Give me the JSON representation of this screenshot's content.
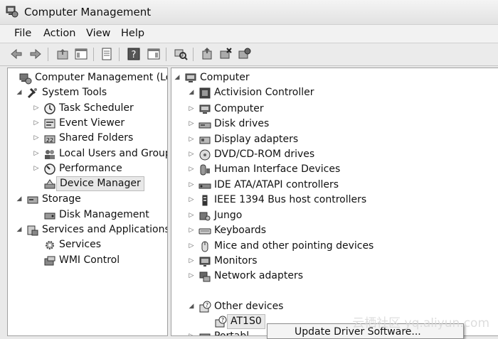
{
  "window": {
    "title": "Computer Management"
  },
  "menu": [
    "File",
    "Action",
    "View",
    "Help"
  ],
  "left_tree": [
    {
      "label": "Computer Management (Local",
      "icon": "computer-management-icon",
      "expanded": null
    },
    {
      "label": "System Tools",
      "icon": "tools-icon",
      "expanded": true
    },
    {
      "label": "Task Scheduler",
      "icon": "clock-icon",
      "expanded": false
    },
    {
      "label": "Event Viewer",
      "icon": "event-viewer-icon",
      "expanded": false
    },
    {
      "label": "Shared Folders",
      "icon": "shared-folder-icon",
      "expanded": false
    },
    {
      "label": "Local Users and Groups",
      "icon": "users-icon",
      "expanded": false
    },
    {
      "label": "Performance",
      "icon": "performance-icon",
      "expanded": false
    },
    {
      "label": "Device Manager",
      "icon": "device-manager-icon",
      "expanded": null,
      "selected": true
    },
    {
      "label": "Storage",
      "icon": "storage-icon",
      "expanded": true
    },
    {
      "label": "Disk Management",
      "icon": "disk-icon",
      "expanded": null
    },
    {
      "label": "Services and Applications",
      "icon": "services-icon",
      "expanded": true
    },
    {
      "label": "Services",
      "icon": "gear-icon",
      "expanded": null
    },
    {
      "label": "WMI Control",
      "icon": "wmi-icon",
      "expanded": null
    }
  ],
  "right_tree": [
    {
      "label": "Computer",
      "icon": "computer-icon",
      "expanded": true
    },
    {
      "label": "Activision Controller",
      "icon": "controller-icon",
      "expanded": true
    },
    {
      "label": "Computer",
      "icon": "computer-icon",
      "expanded": false
    },
    {
      "label": "Disk drives",
      "icon": "disk-drive-icon",
      "expanded": false
    },
    {
      "label": "Display adapters",
      "icon": "display-adapter-icon",
      "expanded": false
    },
    {
      "label": "DVD/CD-ROM drives",
      "icon": "dvd-icon",
      "expanded": false
    },
    {
      "label": "Human Interface Devices",
      "icon": "hid-icon",
      "expanded": false
    },
    {
      "label": "IDE ATA/ATAPI controllers",
      "icon": "ide-icon",
      "expanded": false
    },
    {
      "label": "IEEE 1394 Bus host controllers",
      "icon": "ieee1394-icon",
      "expanded": false
    },
    {
      "label": "Jungo",
      "icon": "jungo-icon",
      "expanded": false
    },
    {
      "label": "Keyboards",
      "icon": "keyboard-icon",
      "expanded": false
    },
    {
      "label": "Mice and other pointing devices",
      "icon": "mouse-icon",
      "expanded": false
    },
    {
      "label": "Monitors",
      "icon": "monitor-icon",
      "expanded": false
    },
    {
      "label": "Network adapters",
      "icon": "network-icon",
      "expanded": false
    },
    {
      "label": "Other devices",
      "icon": "unknown-device-icon",
      "expanded": true
    },
    {
      "label": "AT1S0",
      "icon": "unknown-device-icon",
      "expanded": null,
      "selected": true
    },
    {
      "label": "Portabl",
      "icon": "portable-icon",
      "expanded": false
    }
  ],
  "context_menu": {
    "first_item": "Update Driver Software..."
  },
  "watermark": "云栖社区 yq.aliyun.com"
}
